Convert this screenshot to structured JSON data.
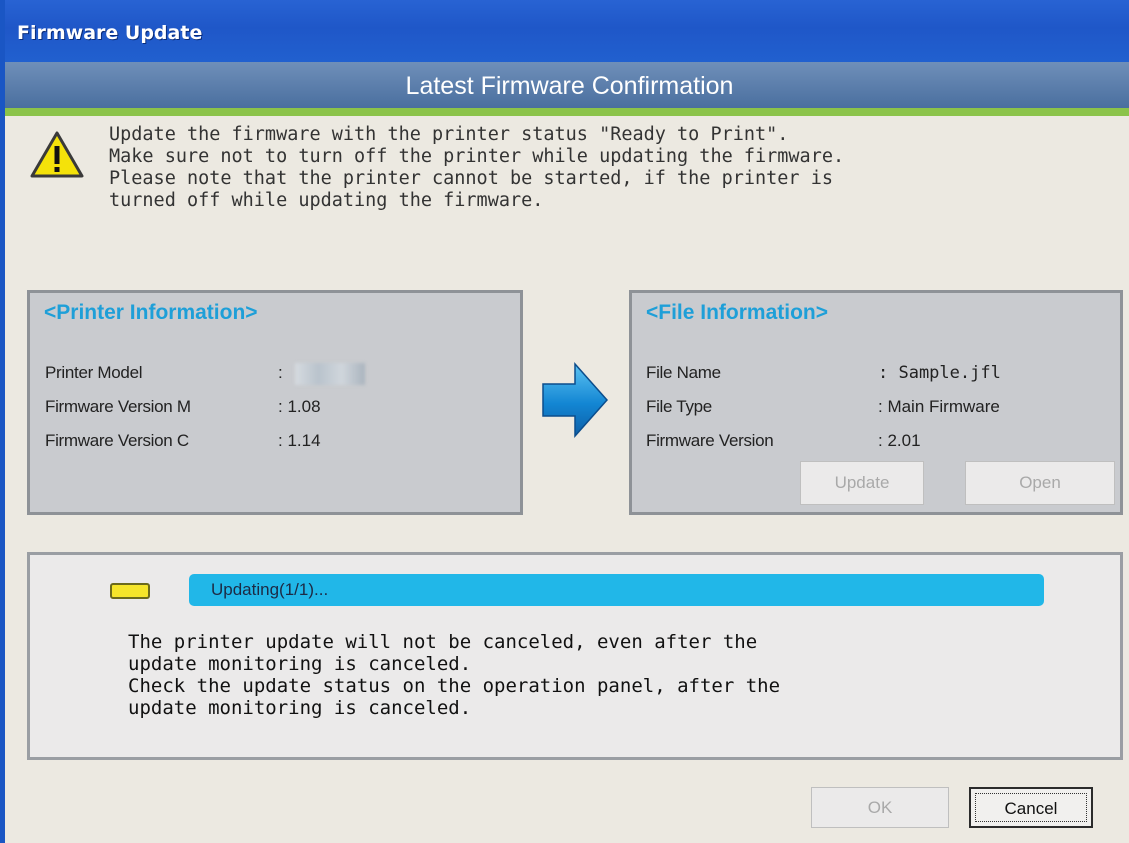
{
  "window": {
    "title": "Firmware Update"
  },
  "header": {
    "band_title": "Latest Firmware Confirmation"
  },
  "warning": {
    "icon": "warning-triangle-icon",
    "text": "Update the firmware with the printer status \"Ready to Print\".\nMake sure not to turn off the printer while updating the firmware.\nPlease note that the printer cannot be started, if the printer is\nturned off while updating the firmware."
  },
  "printer_info": {
    "title": "<Printer Information>",
    "rows": [
      {
        "label": "Printer Model",
        "value": ":"
      },
      {
        "label": "Firmware Version M",
        "value": ": 1.08"
      },
      {
        "label": "Firmware Version C",
        "value": ": 1.14"
      }
    ]
  },
  "file_info": {
    "title": "<File Information>",
    "rows": [
      {
        "label": "File Name",
        "value": ": Sample.jfl"
      },
      {
        "label": "File Type",
        "value": ": Main Firmware"
      },
      {
        "label": "Firmware Version",
        "value": ": 2.01"
      }
    ],
    "update_label": "Update",
    "open_label": "Open"
  },
  "status": {
    "progress_text": "Updating(1/1)...",
    "message": "The printer update will not be canceled, even after the\nupdate monitoring is canceled.\nCheck the update status on the operation panel, after the\nupdate monitoring is canceled."
  },
  "footer": {
    "ok_label": "OK",
    "cancel_label": "Cancel"
  },
  "colors": {
    "titlebar": "#2863d3",
    "panel_title": "#1e9fd8",
    "progress": "#21b7e8",
    "status_led": "#f5e52a",
    "green_line": "#8bc34a"
  }
}
